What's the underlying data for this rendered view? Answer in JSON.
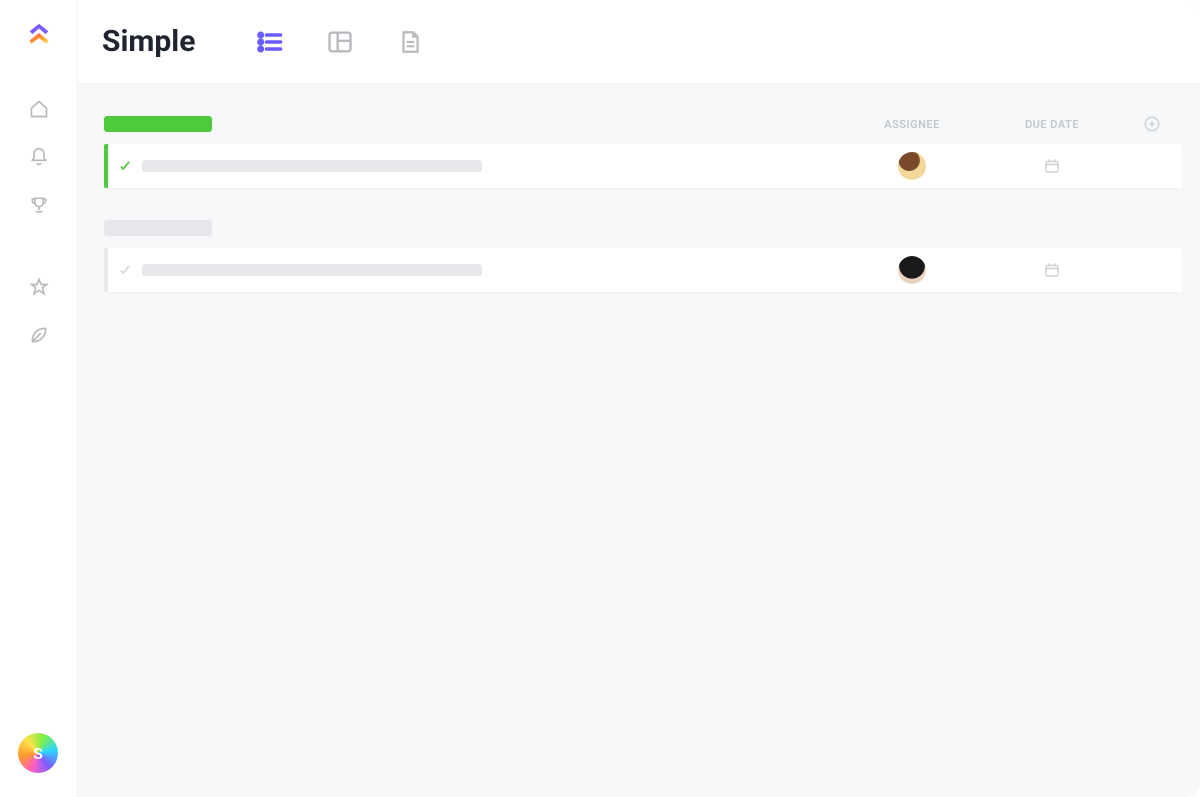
{
  "app": {
    "title": "Simple"
  },
  "columns": {
    "assignee": "ASSIGNEE",
    "due_date": "DUE DATE"
  },
  "user": {
    "initial": "S"
  },
  "colors": {
    "green": "#4ecb3d",
    "gray_pill": "#e5e7ea",
    "purple": "#6a5cff"
  },
  "groups": [
    {
      "status_color": "#4ecb3d",
      "border_color": "#4ecb3d",
      "tasks": [
        {
          "name_width": 340,
          "assignee_avatar": "gradient-orange",
          "has_due": false
        }
      ]
    },
    {
      "status_color": "#e5e7ea",
      "border_color": "#e7e9eb",
      "tasks": [
        {
          "name_width": 340,
          "assignee_avatar": "dark-curly",
          "has_due": false
        }
      ]
    }
  ]
}
